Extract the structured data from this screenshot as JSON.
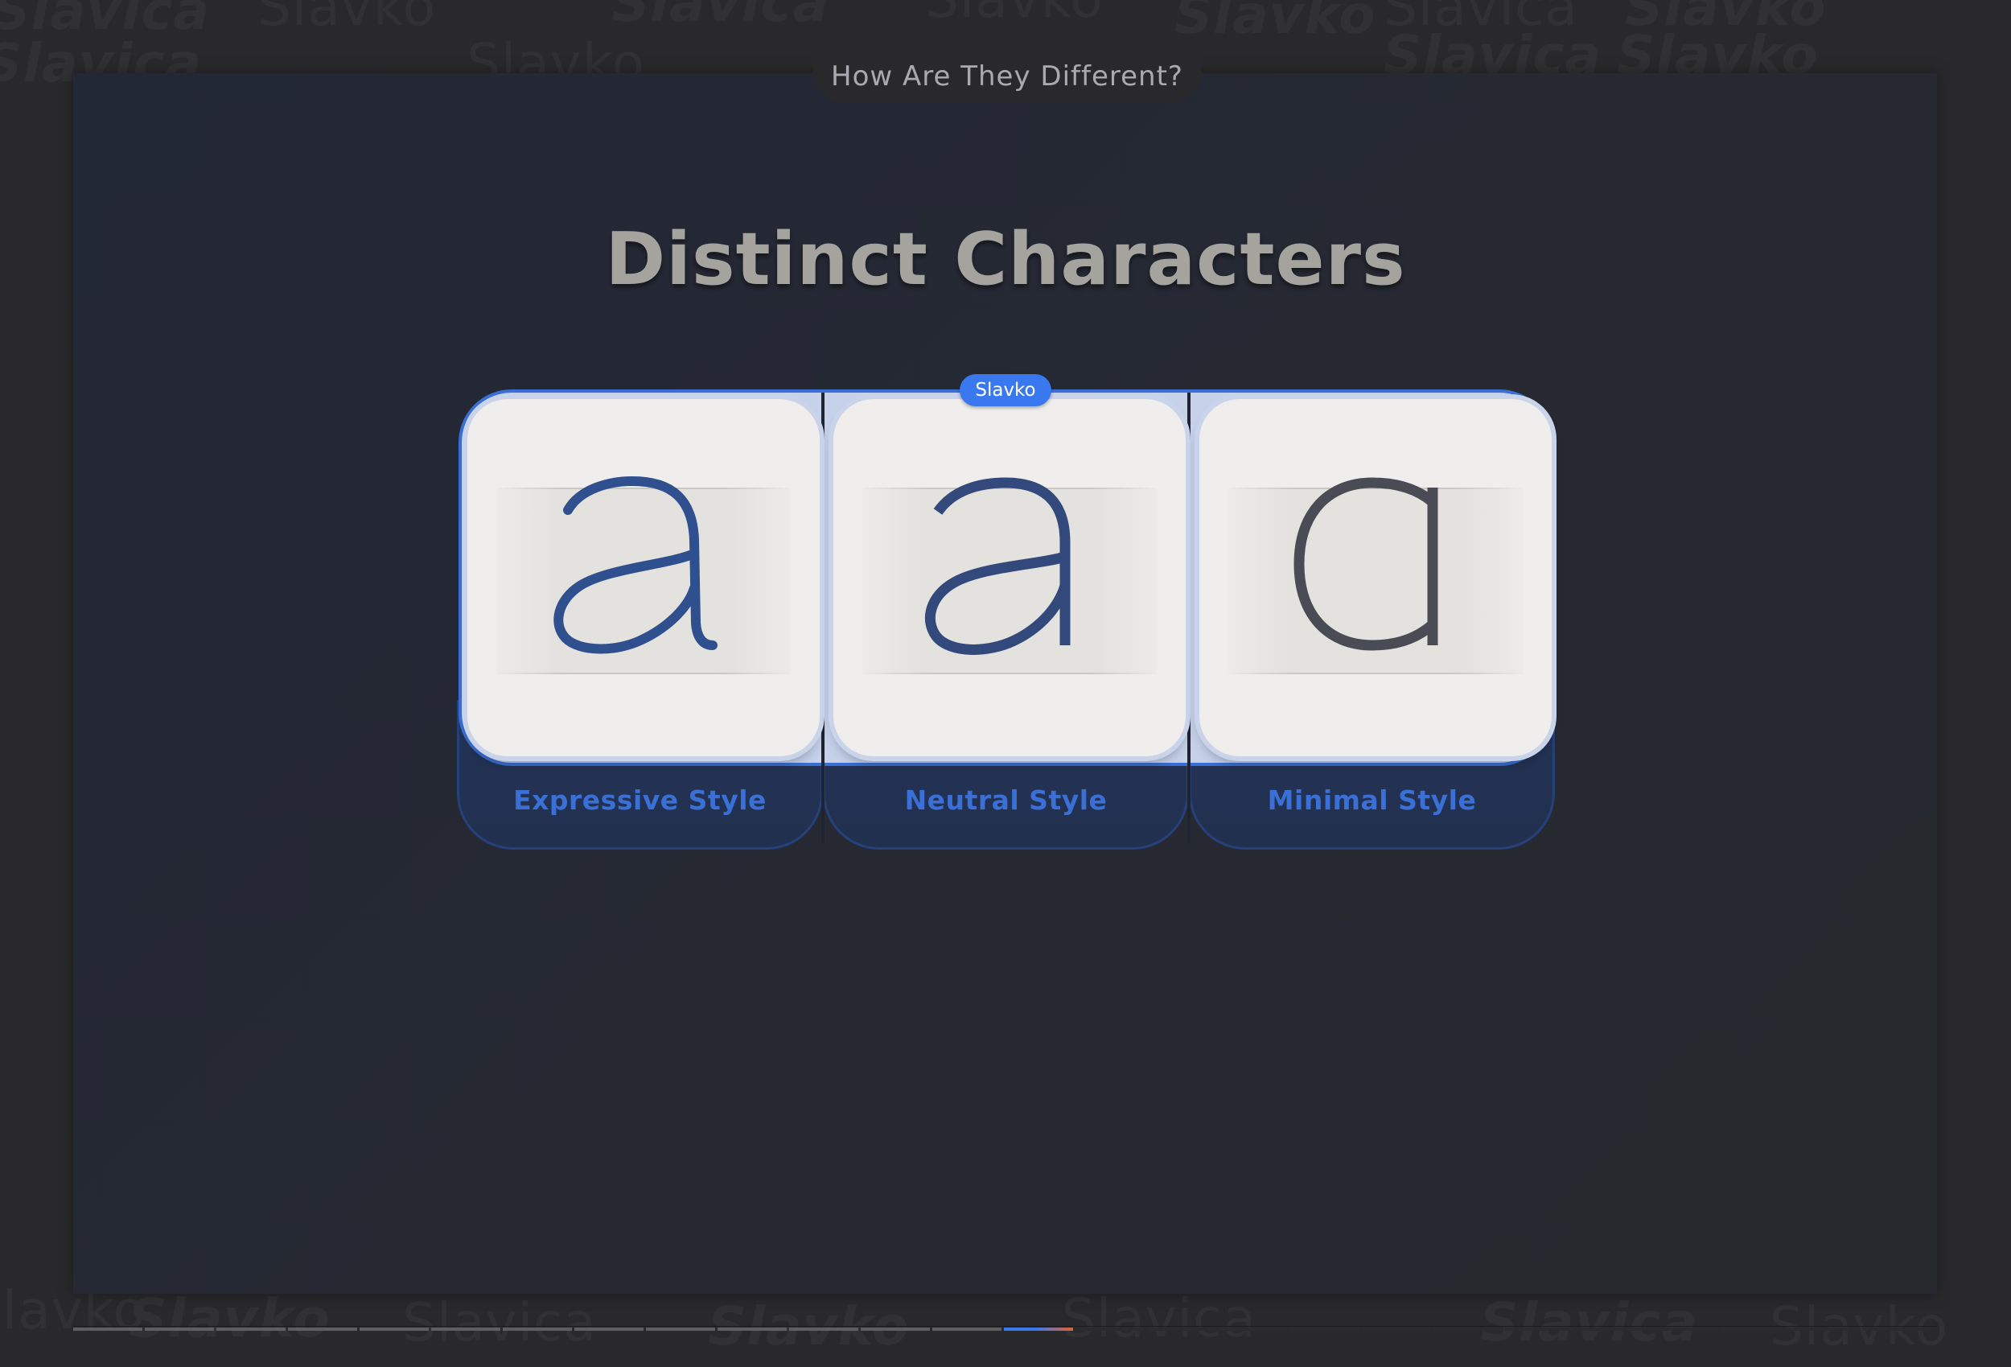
{
  "background_words": [
    "Slavko",
    "Slavica"
  ],
  "header": {
    "section_title": "How Are They Different?"
  },
  "page_title": "Distinct Characters",
  "badge": {
    "label": "Slavko"
  },
  "cards": [
    {
      "glyph": "a",
      "label": "Expressive Style",
      "glyph_color": "#2f4f8f"
    },
    {
      "glyph": "a",
      "label": "Neutral Style",
      "glyph_color": "#33497c"
    },
    {
      "glyph": "a",
      "label": "Minimal Style",
      "glyph_color": "#4a4c55"
    }
  ],
  "progress": {
    "total_steps": 26,
    "completed_steps": 13,
    "current_step": 14
  },
  "colors": {
    "accent": "#3a78f0",
    "label_blue": "#3a6fd6",
    "progress_end": "#e2612f",
    "card_face": "#efeeec",
    "title": "#a5a39e"
  }
}
